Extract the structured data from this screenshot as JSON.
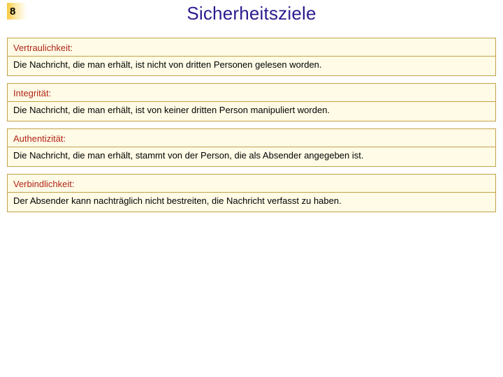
{
  "page_number": "8",
  "title": "Sicherheitsziele",
  "items": [
    {
      "term": "Vertraulichkeit:",
      "desc": "Die Nachricht, die man erhält, ist nicht von dritten Personen gelesen worden."
    },
    {
      "term": "Integrität:",
      "desc": "Die Nachricht, die man erhält, ist von keiner dritten Person manipuliert worden."
    },
    {
      "term": "Authentizität:",
      "desc": "Die Nachricht, die man erhält, stammt von der Person, die als Absender angegeben ist."
    },
    {
      "term": "Verbindlichkeit:",
      "desc": "Der Absender kann nachträglich nicht bestreiten, die Nachricht verfasst zu haben."
    }
  ]
}
